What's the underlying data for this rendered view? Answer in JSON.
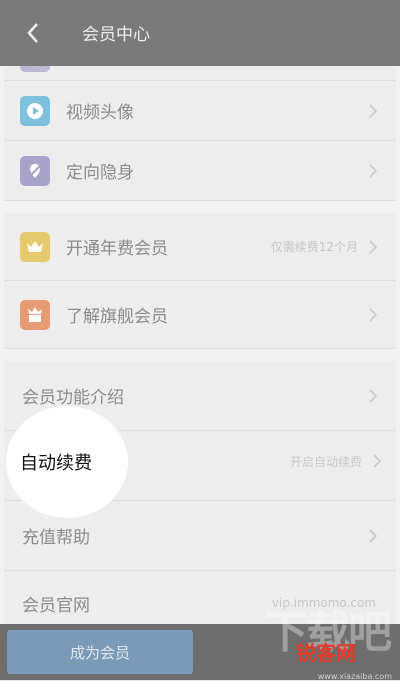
{
  "header": {
    "title": "会员中心",
    "back_icon": "chevron-left-icon"
  },
  "items": [
    {
      "label": "视频头像",
      "icon": "play-icon",
      "color": "#7ec1dc"
    },
    {
      "label": "定向隐身",
      "icon": "location-hidden-icon",
      "color": "#a7a3c9"
    },
    {
      "label": "开通年费会员",
      "icon": "crown-icon",
      "color": "#e4ca6c",
      "sub": "仅需续费12个月"
    },
    {
      "label": "了解旗舰会员",
      "icon": "crown-gift-icon",
      "color": "#e79b73"
    },
    {
      "label": "会员功能介绍"
    },
    {
      "label": "自动续费",
      "sub": "开启自动续费"
    },
    {
      "label": "充值帮助"
    },
    {
      "label": "会员官网",
      "sub": "vip.immomo.com"
    }
  ],
  "bottom": {
    "join_label": "成为会员"
  },
  "watermark": {
    "logo": "下载吧",
    "brand": "锐客网",
    "url": "www.xiazaiba.com"
  },
  "colors": {
    "header": "#7a7a7a",
    "bottom_bar": "#6e6e6e",
    "join_button": "#7b9ab8"
  }
}
